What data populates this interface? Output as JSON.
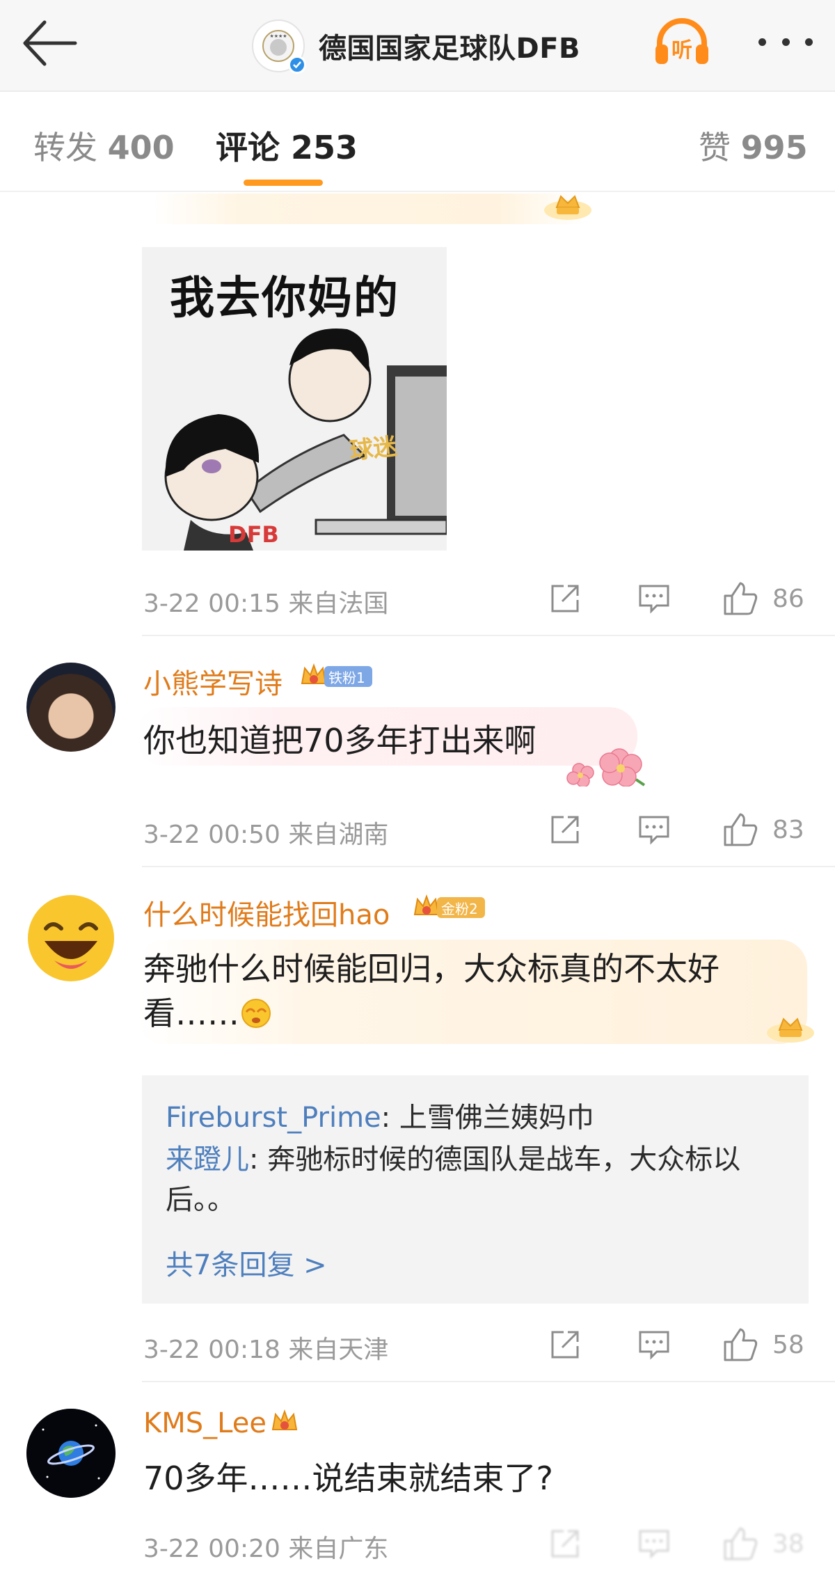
{
  "header": {
    "title": "德国国家足球队DFB",
    "listen_label": "听"
  },
  "tabs": {
    "forward": {
      "label": "转发",
      "count": "400"
    },
    "comments": {
      "label": "评论",
      "count": "253"
    },
    "likes": {
      "label": "赞",
      "count": "995"
    }
  },
  "colors": {
    "accent": "#ff9a1f",
    "username": "#e07b1a",
    "link": "#4e7fbd",
    "meta": "#9a9a9a"
  },
  "comments": [
    {
      "image_caption": "我去你妈的",
      "image_tag_top": "球迷",
      "image_tag_bottom": "DFB",
      "time": "3-22 00:15",
      "location": "来自法国",
      "likes": "86"
    },
    {
      "username": "小熊学写诗",
      "badge": "铁粉1",
      "text": "你也知道把70多年打出来啊",
      "time": "3-22 00:50",
      "location": "来自湖南",
      "likes": "83"
    },
    {
      "username": "什么时候能找回hao",
      "badge": "金粉2",
      "text": "奔驰什么时候能回归，大众标真的不太好看……",
      "replies": [
        {
          "author": "Fireburst_Prime",
          "text": "上雪佛兰姨妈巾"
        },
        {
          "author": "来蹬儿",
          "text": "奔驰标时候的德国队是战车，大众标以后。。"
        }
      ],
      "more_replies": "共7条回复 >",
      "time": "3-22 00:18",
      "location": "来自天津",
      "likes": "58"
    },
    {
      "username": "KMS_Lee",
      "text": "70多年……说结束就结束了?",
      "time": "3-22 00:20",
      "location": "来自广东",
      "likes": "38"
    }
  ],
  "icons": [
    "back-arrow-icon",
    "verified-icon",
    "headphones-icon",
    "more-icon",
    "share-icon",
    "comment-icon",
    "thumbs-up-icon",
    "crown-icon",
    "flower-icon",
    "shy-emoji-icon"
  ]
}
